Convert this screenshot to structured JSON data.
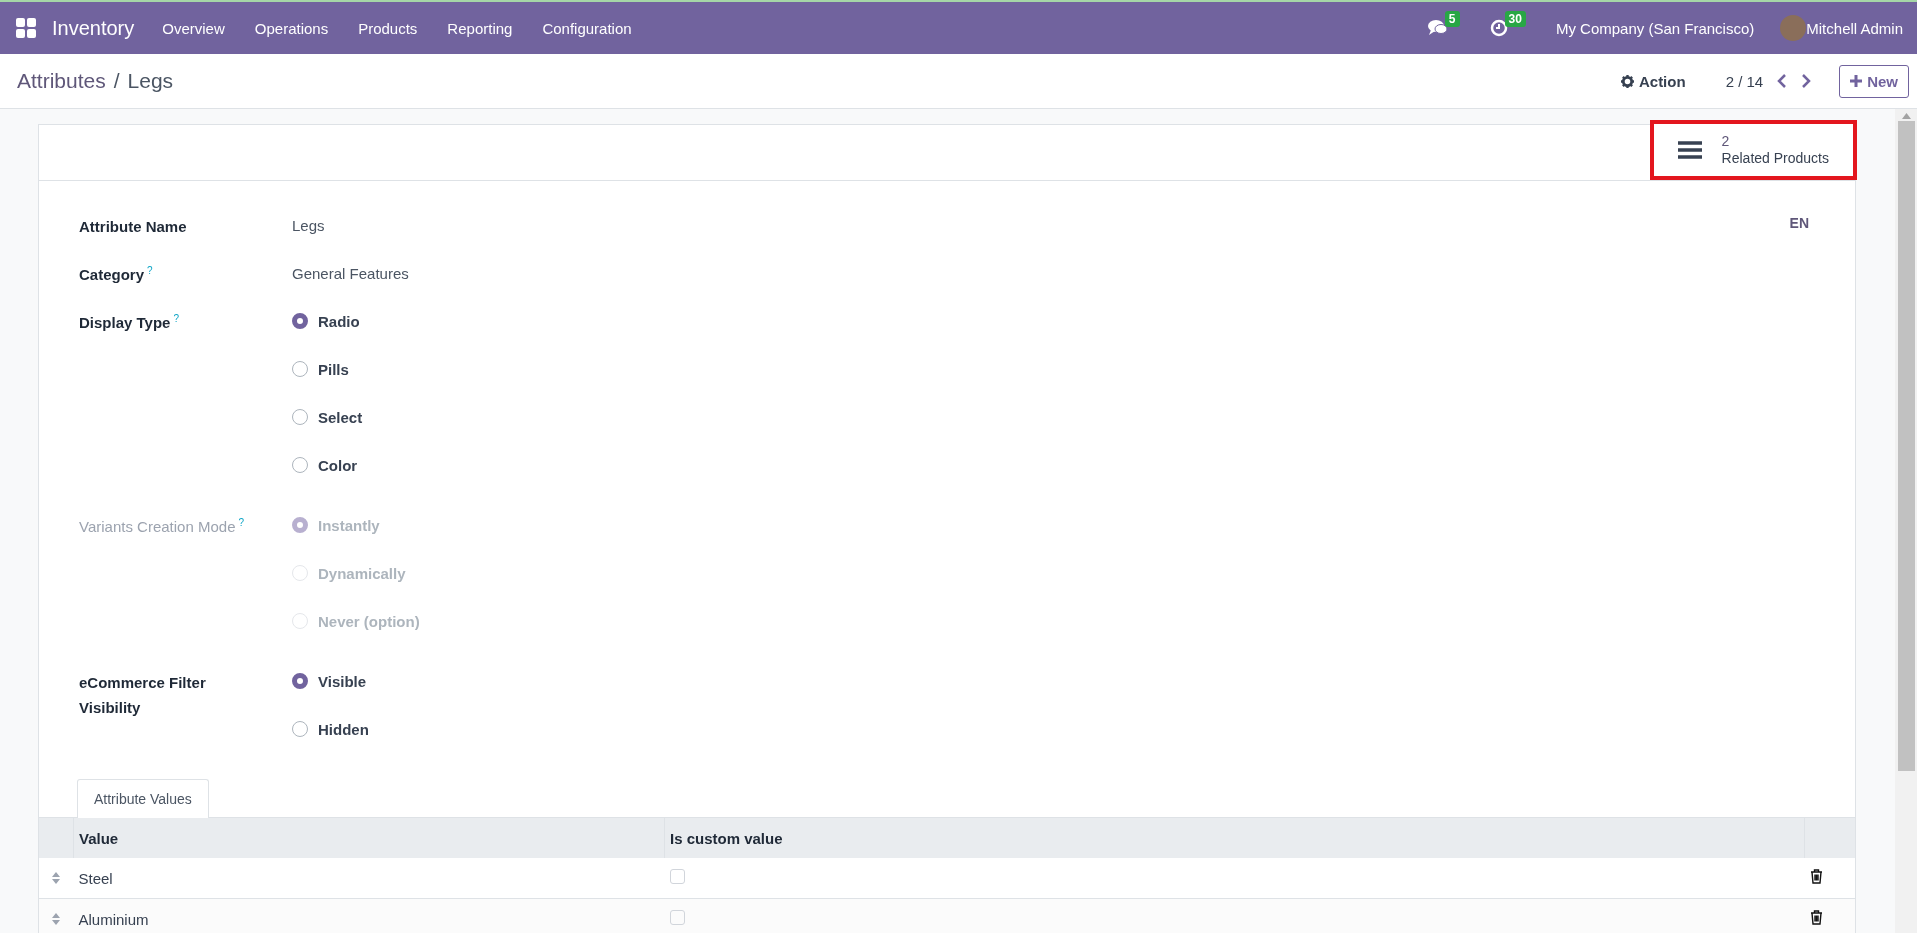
{
  "navbar": {
    "app_name": "Inventory",
    "menu": [
      "Overview",
      "Operations",
      "Products",
      "Reporting",
      "Configuration"
    ],
    "messages_count": "5",
    "activities_count": "30",
    "company": "My Company (San Francisco)",
    "user": "Mitchell Admin"
  },
  "breadcrumb": {
    "parent": "Attributes",
    "separator": "/",
    "current": "Legs"
  },
  "control_panel": {
    "action": "Action",
    "pager": "2 / 14",
    "new_button": "New"
  },
  "smart_button": {
    "count": "2",
    "label": "Related Products",
    "highlighted": true
  },
  "language": "EN",
  "fields": [
    {
      "kind": "text",
      "label": "Attribute Name",
      "disabled": false,
      "value": "Legs"
    },
    {
      "kind": "text",
      "label": "Category",
      "help": "?",
      "disabled": false,
      "value": "General Features"
    },
    {
      "kind": "radio",
      "label": "Display Type",
      "help": "?",
      "disabled": false,
      "options": [
        {
          "label": "Radio",
          "selected": true
        },
        {
          "label": "Pills",
          "selected": false
        },
        {
          "label": "Select",
          "selected": false
        },
        {
          "label": "Color",
          "selected": false
        }
      ]
    },
    {
      "kind": "radio",
      "label": "Variants Creation Mode",
      "help": "?",
      "disabled": true,
      "options": [
        {
          "label": "Instantly",
          "selected": true
        },
        {
          "label": "Dynamically",
          "selected": false
        },
        {
          "label": "Never (option)",
          "selected": false
        }
      ]
    },
    {
      "kind": "radio",
      "label": "eCommerce Filter Visibility",
      "disabled": false,
      "options": [
        {
          "label": "Visible",
          "selected": true
        },
        {
          "label": "Hidden",
          "selected": false
        }
      ]
    }
  ],
  "tabs": [
    {
      "label": "Attribute Values",
      "selected": true
    }
  ],
  "table": {
    "columns": [
      "Value",
      "Is custom value"
    ],
    "rows": [
      {
        "value": "Steel",
        "is_custom_value": false
      },
      {
        "value": "Aluminium",
        "is_custom_value": false
      }
    ]
  }
}
